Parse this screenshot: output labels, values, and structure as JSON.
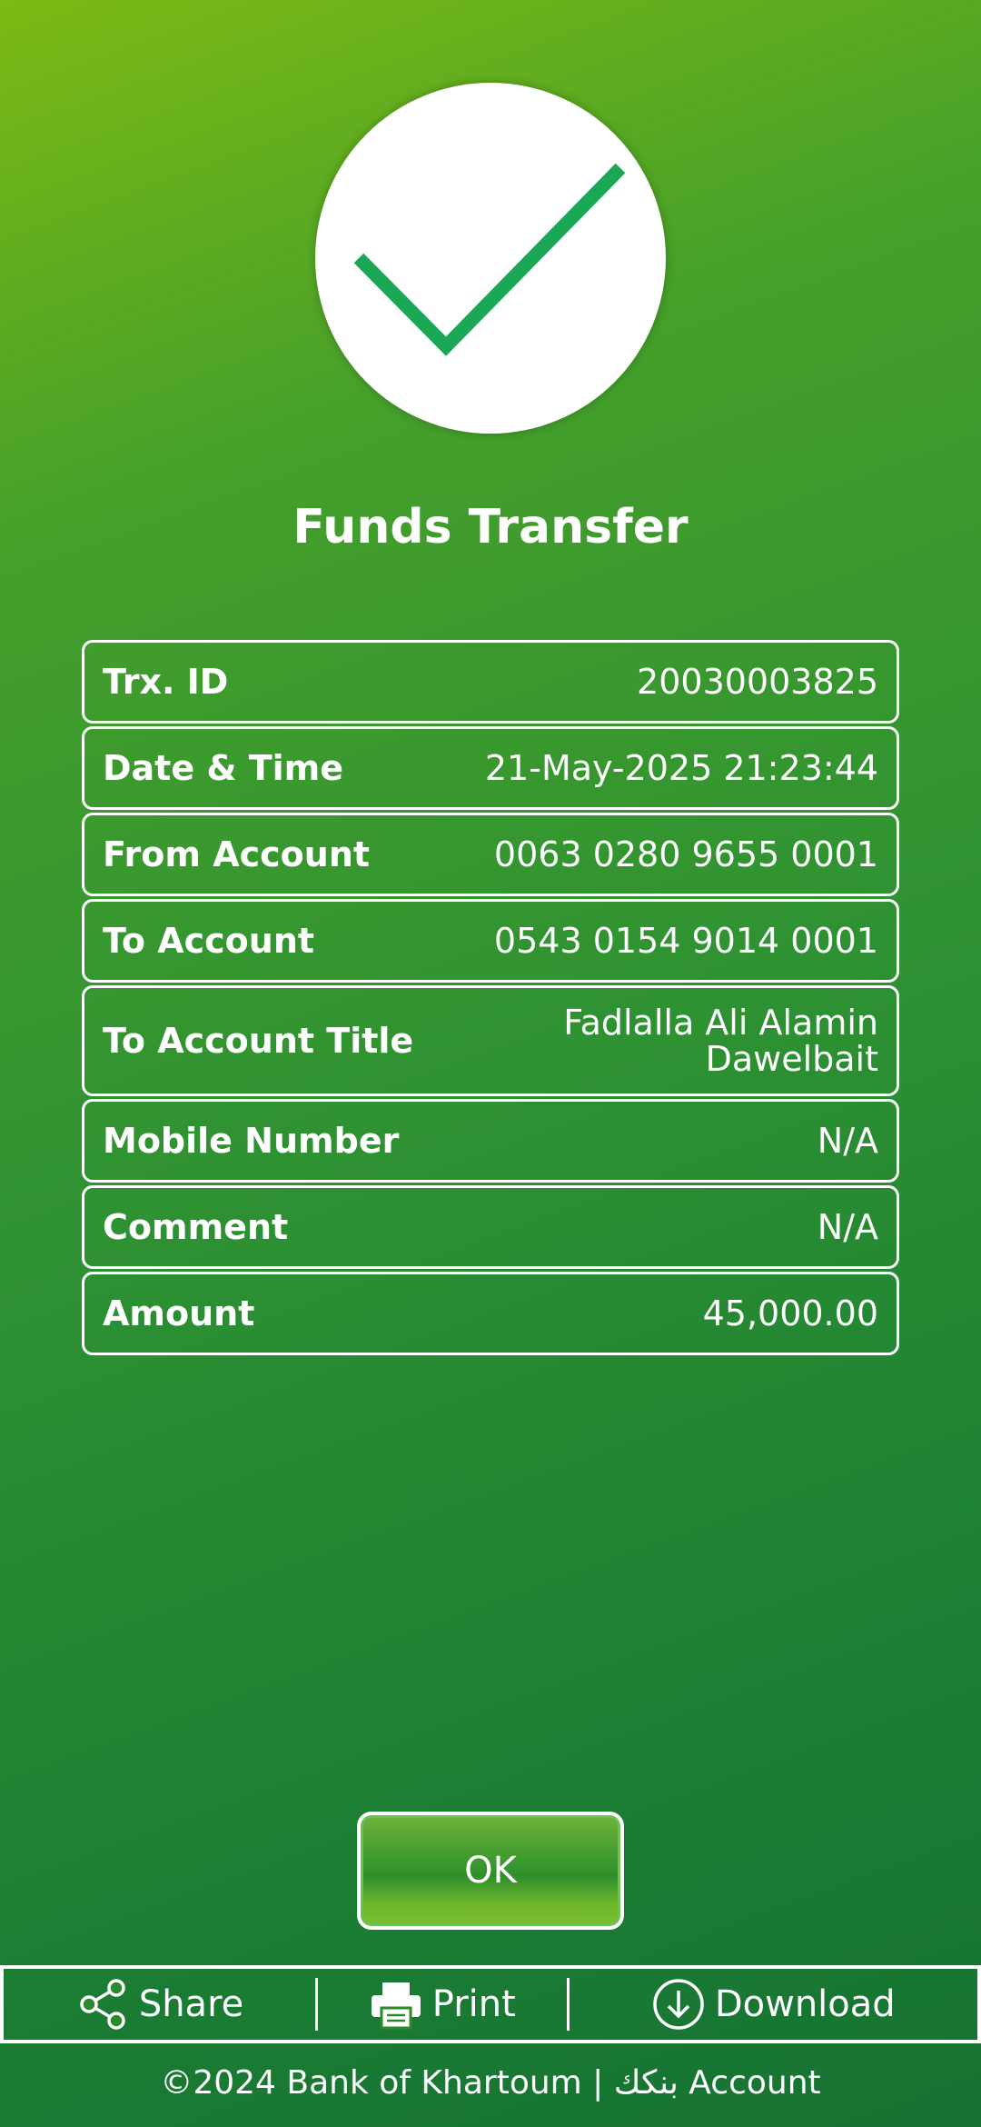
{
  "header": {
    "title": "Funds Transfer"
  },
  "details": [
    {
      "label": "Trx. ID",
      "value": "20030003825"
    },
    {
      "label": "Date & Time",
      "value": "21-May-2025 21:23:44"
    },
    {
      "label": "From Account",
      "value": "0063 0280 9655 0001"
    },
    {
      "label": "To Account",
      "value": "0543 0154 9014 0001"
    },
    {
      "label": "To Account Title",
      "value": "Fadlalla Ali Alamin Dawelbait"
    },
    {
      "label": "Mobile Number",
      "value": "N/A"
    },
    {
      "label": "Comment",
      "value": "N/A"
    },
    {
      "label": "Amount",
      "value": "45,000.00"
    }
  ],
  "buttons": {
    "ok_label": "OK"
  },
  "actions": {
    "share_label": "Share",
    "print_label": "Print",
    "download_label": "Download"
  },
  "footer": {
    "text": "©2024 Bank of Khartoum | بنكك Account"
  },
  "icons": {
    "status": "checkmark-icon",
    "share": "share-icon",
    "print": "printer-icon",
    "download": "download-icon"
  },
  "colors": {
    "background_top": "#7cba14",
    "background_bottom": "#177233",
    "checkmark": "#1aa856"
  }
}
